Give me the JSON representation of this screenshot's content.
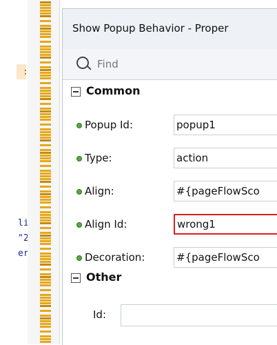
{
  "editor": {
    "fragments": [
      ":",
      "li",
      "\"2",
      "er"
    ]
  },
  "panel": {
    "title": "Show Popup Behavior - Proper",
    "search": {
      "placeholder": "Find"
    },
    "sections": {
      "common": {
        "label": "Common"
      },
      "other": {
        "label": "Other"
      }
    },
    "properties": [
      {
        "label": "Popup Id:",
        "value": "popup1"
      },
      {
        "label": "Type:",
        "value": "action"
      },
      {
        "label": "Align:",
        "value": "#{pageFlowSco"
      },
      {
        "label": "Align Id:",
        "value": "wrong1"
      },
      {
        "label": "Decoration:",
        "value": "#{pageFlowSco"
      }
    ],
    "other_id": {
      "label": "Id:",
      "value": ""
    }
  },
  "colors": {
    "marker": "#e6a817",
    "error_border": "#d71e1e",
    "required_dot": "#5aa93a"
  }
}
